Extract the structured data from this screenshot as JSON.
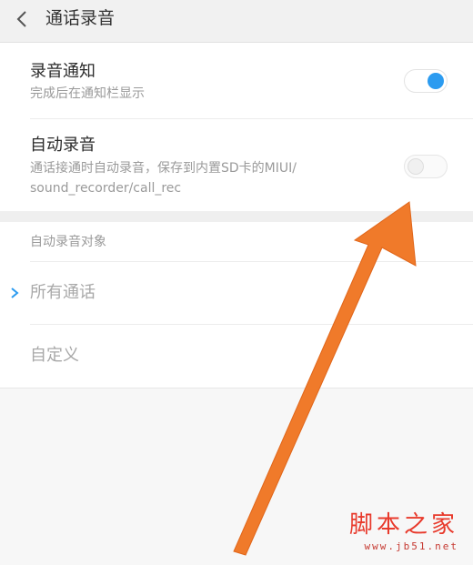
{
  "header": {
    "back_icon": "chevron-left-icon",
    "title": "通话录音"
  },
  "settings": [
    {
      "title": "录音通知",
      "subtitle": "完成后在通知栏显示",
      "toggle_on": true
    },
    {
      "title": "自动录音",
      "subtitle_line1": "通话接通时自动录音，保存到内置SD卡的MIUI/",
      "subtitle_line2": "sound_recorder/call_rec",
      "toggle_on": false
    }
  ],
  "auto_record_target": {
    "header": "自动录音对象",
    "options": [
      {
        "label": "所有通话",
        "selected": true
      },
      {
        "label": "自定义",
        "selected": false
      }
    ]
  },
  "watermark": {
    "title": "脚本之家",
    "url": "www.jb51.net"
  },
  "colors": {
    "accent": "#2b9bf0",
    "arrow": "#f07a2a",
    "watermark": "#e83a2c"
  }
}
